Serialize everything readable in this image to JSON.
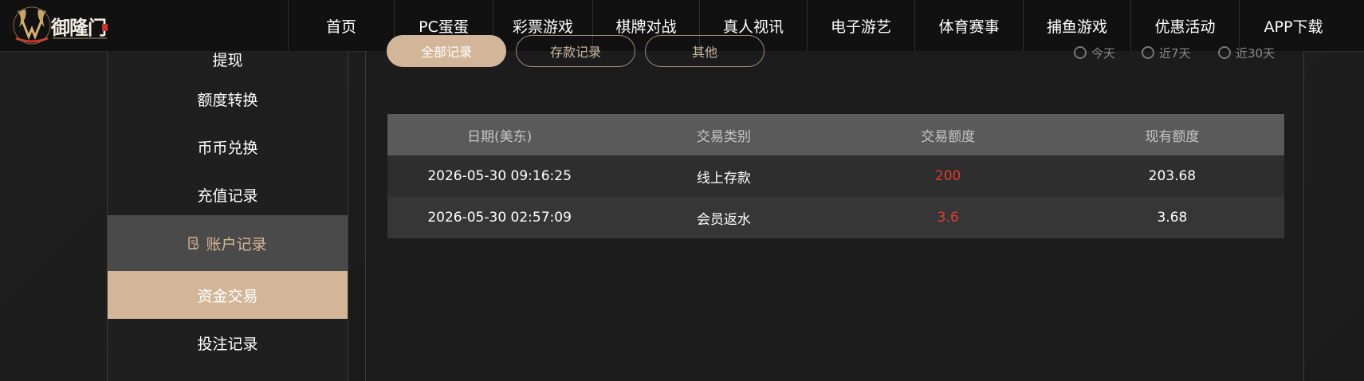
{
  "brand": {
    "name": "御隆门"
  },
  "nav": {
    "items": [
      "首页",
      "PC蛋蛋",
      "彩票游戏",
      "棋牌对战",
      "真人视讯",
      "电子游艺",
      "体育赛事",
      "捕鱼游戏",
      "优惠活动",
      "APP下载"
    ]
  },
  "sidebar": {
    "cut_item": "提现",
    "items": [
      "额度转换",
      "币币兑换",
      "充值记录"
    ],
    "section_header": "账户记录",
    "active_item": "资金交易",
    "after_items": [
      "投注记录"
    ]
  },
  "filters": {
    "buttons": [
      "全部记录",
      "存款记录",
      "其他"
    ],
    "radios": [
      "今天",
      "近7天",
      "近30天"
    ]
  },
  "table": {
    "headers": [
      "日期(美东)",
      "交易类别",
      "交易额度",
      "现有额度"
    ],
    "rows": [
      [
        "2026-05-30 09:16:25",
        "线上存款",
        "200",
        "203.68"
      ],
      [
        "2026-05-30 02:57:09",
        "会员返水",
        "3.6",
        "3.68"
      ]
    ]
  },
  "colors": {
    "accent_gold": "#d3b699",
    "amount_red": "#e03b30",
    "header_gray": "#5a5a5a"
  }
}
